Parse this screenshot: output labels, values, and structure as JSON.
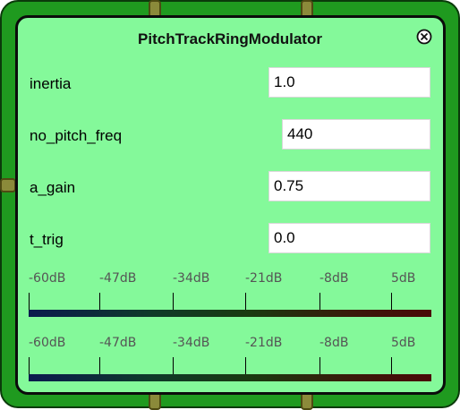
{
  "window": {
    "title": "PitchTrackRingModulator",
    "close_icon": "close-circle-x-icon"
  },
  "params": [
    {
      "label": "inertia",
      "value": "1.0"
    },
    {
      "label": "no_pitch_freq",
      "value": "440"
    },
    {
      "label": "a_gain",
      "value": "0.75"
    },
    {
      "label": "t_trig",
      "value": "0.0"
    }
  ],
  "meters": [
    {
      "labels": [
        "-60dB",
        "-47dB",
        "-34dB",
        "-21dB",
        "-8dB",
        "5dB"
      ]
    },
    {
      "labels": [
        "-60dB",
        "-47dB",
        "-34dB",
        "-21dB",
        "-8dB",
        "5dB"
      ]
    }
  ],
  "colors": {
    "frame_outer": "#1f9a1f",
    "frame_inner": "#84f99a",
    "connector": "#8b8a3a"
  }
}
